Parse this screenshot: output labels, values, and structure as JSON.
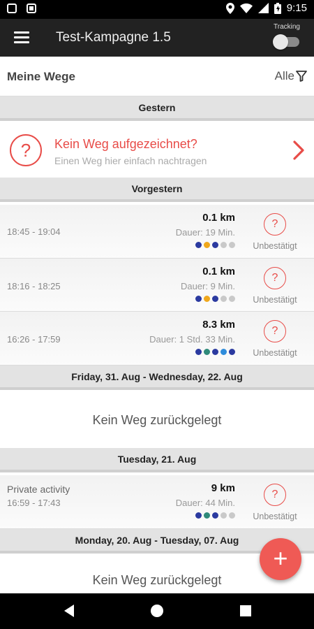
{
  "status_bar": {
    "time": "9:15",
    "icons": [
      "square-icon",
      "sd-card-icon",
      "location-icon",
      "wifi-icon",
      "signal-icon",
      "battery-icon"
    ]
  },
  "app_bar": {
    "menu_icon": "hamburger-icon",
    "title": "Test-Kampagne 1.5",
    "tracking_label": "Tracking",
    "tracking_enabled": false
  },
  "list_header": {
    "title": "Meine Wege",
    "filter_label": "Alle",
    "filter_icon": "filter-icon"
  },
  "sections": [
    {
      "label": "Gestern"
    },
    {
      "label": "Vorgestern"
    },
    {
      "label": "Friday, 31. Aug - Wednesday, 22. Aug"
    },
    {
      "label": "Tuesday, 21. Aug"
    },
    {
      "label": "Monday, 20. Aug - Tuesday, 07. Aug"
    }
  ],
  "missing_way": {
    "title": "Kein Weg aufgezeichnet?",
    "subtitle": "Einen Weg hier einfach nachtragen",
    "icon": "question-circle-icon",
    "chevron": "chevron-right-icon"
  },
  "trips": [
    {
      "activity": "",
      "time": "18:45 - 19:04",
      "distance": "0.1 km",
      "duration": "Dauer: 19 Min.",
      "dots": [
        "#2b3aa0",
        "#f0a81c",
        "#2b3aa0",
        "#c9c9c9",
        "#c9c9c9"
      ],
      "status": "Unbestätigt"
    },
    {
      "activity": "",
      "time": "18:16 - 18:25",
      "distance": "0.1 km",
      "duration": "Dauer: 9 Min.",
      "dots": [
        "#2b3aa0",
        "#f0a81c",
        "#2b3aa0",
        "#c9c9c9",
        "#c9c9c9"
      ],
      "status": "Unbestätigt"
    },
    {
      "activity": "",
      "time": "16:26 - 17:59",
      "distance": "8.3 km",
      "duration": "Dauer: 1 Std. 33 Min.",
      "dots": [
        "#2b3aa0",
        "#2f8a7a",
        "#2b3aa0",
        "#2f8cdb",
        "#2b3aa0"
      ],
      "status": "Unbestätigt"
    },
    {
      "activity": "Private activity",
      "time": "16:59 - 17:43",
      "distance": "9 km",
      "duration": "Dauer: 44 Min.",
      "dots": [
        "#2b3aa0",
        "#2f8a7a",
        "#2b3aa0",
        "#c9c9c9",
        "#c9c9c9"
      ],
      "status": "Unbestätigt"
    }
  ],
  "empty_text": "Kein Weg zurückgelegt",
  "fab_icon": "plus-icon",
  "nav": [
    "back-icon",
    "home-icon",
    "recents-icon"
  ],
  "colors": {
    "accent": "#e84c48",
    "fab": "#ef5a55",
    "app_bar": "#222222"
  }
}
